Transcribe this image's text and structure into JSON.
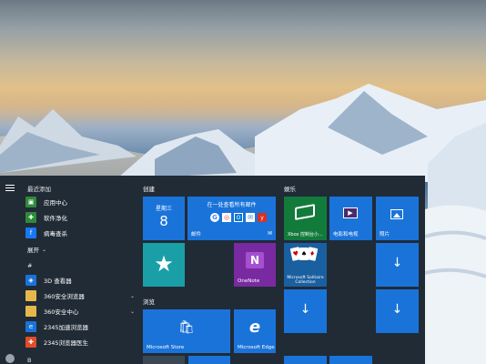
{
  "start_menu": {
    "recent_header": "最近添加",
    "recent_apps": [
      {
        "label": "应用中心",
        "icon": "app-center-icon",
        "color": "#2d8a3a"
      },
      {
        "label": "软件净化",
        "icon": "software-cleanup-icon",
        "color": "#2d8a3a"
      },
      {
        "label": "病毒查杀",
        "icon": "virus-scan-icon",
        "color": "#1877f2"
      }
    ],
    "expand_label": "展开",
    "hash_header": "#",
    "hash_apps": [
      {
        "label": "3D 查看器",
        "icon": "cube-3d-icon",
        "color": "#1a73d9",
        "chevron": false
      },
      {
        "label": "360安全浏览器",
        "icon": "folder-icon",
        "color": "#e6b84b",
        "chevron": true
      },
      {
        "label": "360安全中心",
        "icon": "folder-icon",
        "color": "#e6b84b",
        "chevron": true
      },
      {
        "label": "2345加速浏览器",
        "icon": "browser-2345-icon",
        "color": "#1a73d9",
        "chevron": false
      },
      {
        "label": "2345浏览器医生",
        "icon": "browser-doctor-icon",
        "color": "#e04b2b",
        "chevron": false
      }
    ],
    "b_header": "B",
    "groups": {
      "create": "创建",
      "play": "娱乐",
      "browse": "浏览"
    },
    "tiles": {
      "calendar_weekday": "星期三",
      "calendar_day": "8",
      "mail_header": "在一处查看所有邮件",
      "mail_label": "邮件",
      "onenote_label": "OneNote",
      "store_label": "Microsoft Store",
      "edge_label": "Microsoft Edge",
      "xbox_label": "Xbox 控制台小...",
      "movies_label": "电影和电视",
      "photos_label": "照片",
      "solitaire_label": "Microsoft Solitaire Collection"
    },
    "colors": {
      "panel": "#202b36",
      "tile_blue": "#1a73d9",
      "featured_teal": "#1a9fa6",
      "onenote_purple": "#7a2aa0",
      "xbox_green": "#127b3c"
    }
  }
}
